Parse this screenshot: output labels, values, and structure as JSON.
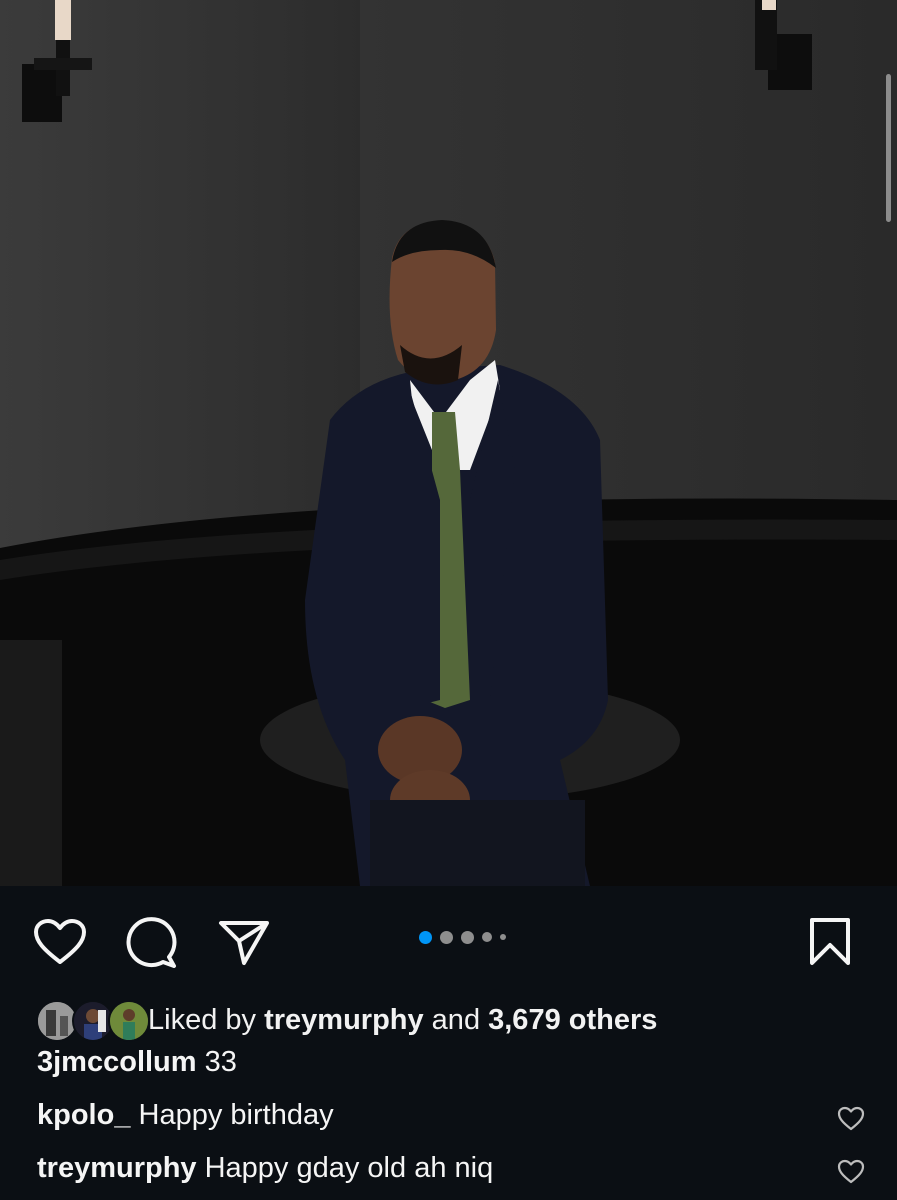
{
  "post": {
    "image_alt": "Man in navy cardigan with green tie seated in dark lounge",
    "carousel": {
      "count": 5,
      "active_index": 0
    }
  },
  "icons": {
    "like": "heart-icon",
    "comment": "comment-bubble-icon",
    "share": "paper-plane-icon",
    "save": "bookmark-icon"
  },
  "likes": {
    "prefix": "Liked by ",
    "user": "treymurphy",
    "middle": " and ",
    "count": "3,679 others"
  },
  "caption": {
    "user": "3jmccollum",
    "text": " 33"
  },
  "comments": [
    {
      "user": "kpolo_",
      "text": " Happy birthday"
    },
    {
      "user": "treymurphy",
      "text": " Happy gday old ah niq"
    }
  ],
  "colors": {
    "background": "#0b0f14",
    "accent": "#0095f6",
    "text": "#f5f5f5"
  }
}
